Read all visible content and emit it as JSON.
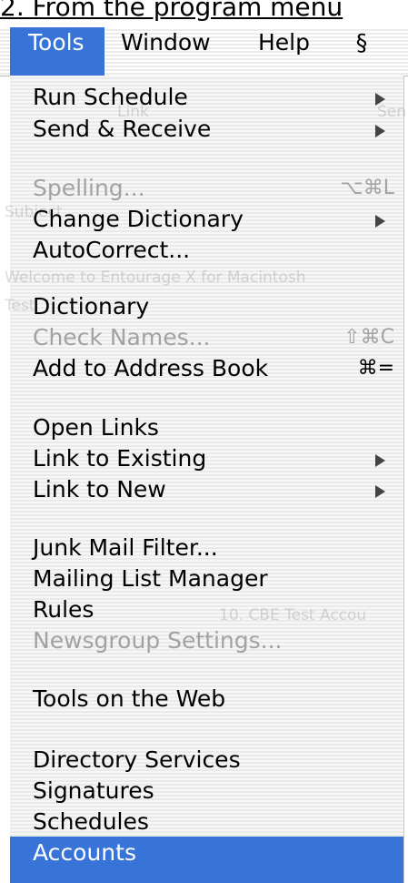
{
  "caption": "2. From the program menu",
  "menubar": {
    "tools": "Tools",
    "window": "Window",
    "help": "Help",
    "script_glyph": "§"
  },
  "background_ghost": [
    "Link",
    "Sen",
    "Subject",
    "Welcome to Entourage X for Macintosh",
    "Test",
    "10. CBE Test Accou"
  ],
  "menu": {
    "run_schedule": "Run Schedule",
    "send_receive": "Send & Receive",
    "spelling": "Spelling...",
    "spelling_shortcut": "⌥⌘L",
    "change_dictionary": "Change Dictionary",
    "autocorrect": "AutoCorrect...",
    "dictionary": "Dictionary",
    "check_names": "Check Names...",
    "check_names_shortcut": "⇧⌘C",
    "add_to_address_book": "Add to Address Book",
    "add_to_address_book_shortcut": "⌘=",
    "open_links": "Open Links",
    "link_to_existing": "Link to Existing",
    "link_to_new": "Link to New",
    "junk_mail_filter": "Junk Mail Filter...",
    "mailing_list_manager": "Mailing List Manager",
    "rules": "Rules",
    "newsgroup_settings": "Newsgroup Settings...",
    "tools_on_the_web": "Tools on the Web",
    "directory_services": "Directory Services",
    "signatures": "Signatures",
    "schedules": "Schedules",
    "accounts": "Accounts"
  },
  "colors": {
    "highlight": "#3874d8",
    "disabled_text": "#a2a2a2"
  }
}
